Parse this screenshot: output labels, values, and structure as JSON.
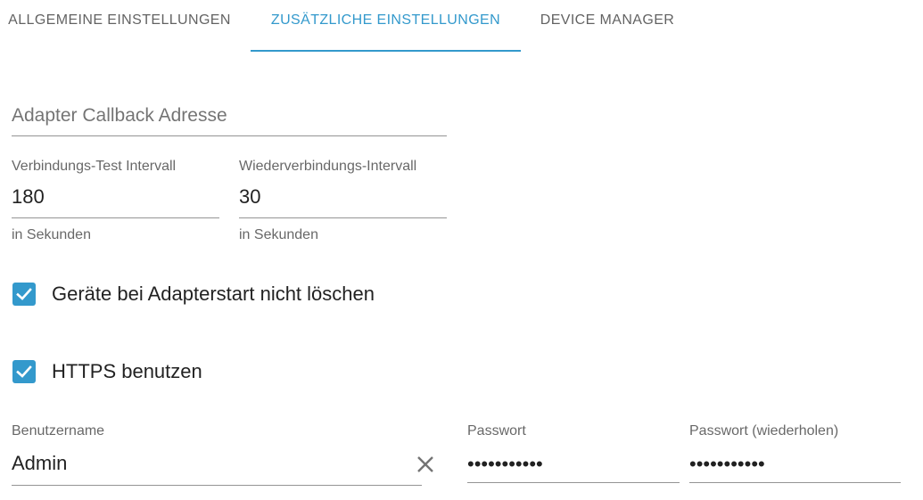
{
  "tabs": [
    {
      "label": "Allgemeine Einstellungen",
      "active": false
    },
    {
      "label": "Zusätzliche Einstellungen",
      "active": true
    },
    {
      "label": "Device Manager",
      "active": false
    }
  ],
  "accent_color": "#3399cc",
  "callback": {
    "placeholder": "Adapter Callback Adresse",
    "value": ""
  },
  "test_interval": {
    "label": "Verbindungs-Test Intervall",
    "value": "180",
    "helper": "in Sekunden"
  },
  "reconnect_interval": {
    "label": "Wiederverbindungs-Intervall",
    "value": "30",
    "helper": "in Sekunden"
  },
  "keep_devices": {
    "label": "Geräte bei Adapterstart nicht löschen",
    "checked": true
  },
  "use_https": {
    "label": "HTTPS benutzen",
    "checked": true
  },
  "username": {
    "label": "Benutzername",
    "value": "Admin",
    "clear_icon": "close-icon"
  },
  "password": {
    "label": "Passwort",
    "value": "•••••••••••"
  },
  "password_repeat": {
    "label": "Passwort (wiederholen)",
    "value": "•••••••••••"
  }
}
